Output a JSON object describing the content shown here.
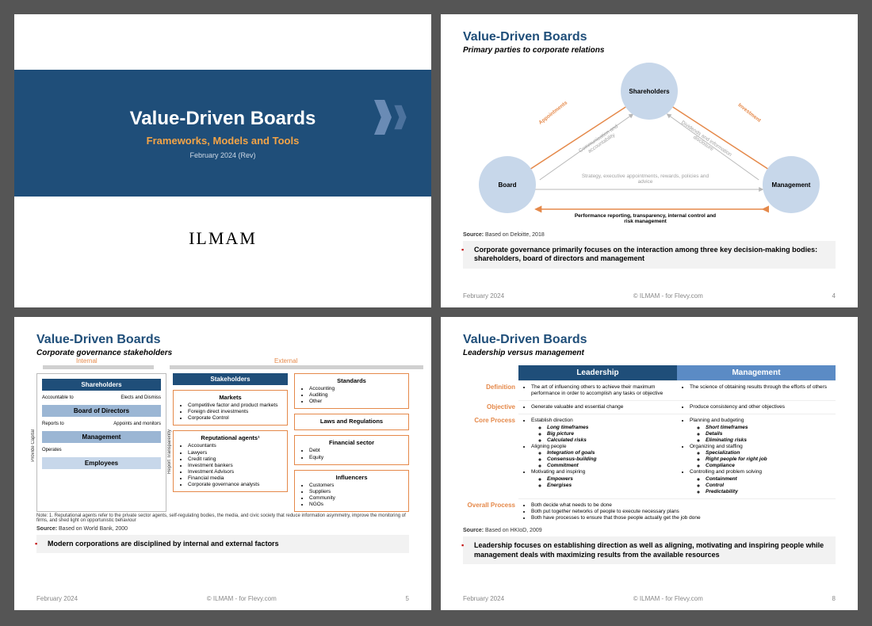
{
  "brand": "ILMAM",
  "footer": {
    "date": "February 2024",
    "copy": "© ILMAM - for Flevy.com"
  },
  "slide1": {
    "title": "Value-Driven Boards",
    "subtitle": "Frameworks, Models and Tools",
    "date": "February 2024 (Rev)"
  },
  "slide2": {
    "section": "Value-Driven Boards",
    "sub": "Primary parties to corporate relations",
    "nodes": {
      "sh": "Shareholders",
      "bd": "Board",
      "mg": "Management"
    },
    "labels": {
      "app": "Appointments",
      "inv": "Investment",
      "comm": "Communication and accountability",
      "div": "Dividends and information disclosure",
      "strat": "Strategy, executive appointments, rewards, policies and advice",
      "perf": "Performance reporting, transparency, internal control and risk management"
    },
    "source": "Source: Based on Deloitte, 2018",
    "key": "Corporate governance primarily focuses on the interaction among three key decision-making bodies: shareholders, board of directors and management",
    "page": "4"
  },
  "slide3": {
    "section": "Value-Driven Boards",
    "sub": "Corporate governance stakeholders",
    "internal": "Internal",
    "external": "External",
    "intbox": {
      "sh": "Shareholders",
      "sh_l": "Accountable to",
      "sh_r": "Elects and Dismiss",
      "bd": "Board of Directors",
      "bd_l": "Reports to",
      "bd_r": "Appoints and monitors",
      "mg": "Management",
      "mg_l": "Operates",
      "em": "Employees",
      "side_l": "Provide Capital",
      "side_r": "Report Transparently"
    },
    "stakeholders": "Stakeholders",
    "markets": {
      "h": "Markets",
      "items": [
        "Competitive factor and product markets",
        "Foreign direct investments",
        "Corporate Control"
      ]
    },
    "rep": {
      "h": "Reputational agents¹",
      "items": [
        "Accountants",
        "Lawyers",
        "Credit rating",
        "Investment bankers",
        "Investment Advisors",
        "Financial media",
        "Corporate governance analysts"
      ]
    },
    "standards": {
      "h": "Standards",
      "items": [
        "Accounting",
        "Auditing",
        "Other"
      ]
    },
    "laws": "Laws and Regulations",
    "fin": {
      "h": "Financial sector",
      "items": [
        "Debt",
        "Equity"
      ]
    },
    "inf": {
      "h": "Influencers",
      "items": [
        "Customers",
        "Suppliers",
        "Community",
        "NGOs"
      ]
    },
    "note": "Note: 1. Reputational agents refer to the private sector agents, self-regulating bodies, the media, and civic society that reduce information asymmetry, improve the monitoring of firms, and shed light on opportunistic behaviour",
    "source": "Source: Based on World Bank, 2000",
    "key": "Modern corporations are disciplined by internal and external factors",
    "page": "5"
  },
  "slide4": {
    "section": "Value-Driven Boards",
    "sub": "Leadership versus management",
    "head": {
      "l": "Leadership",
      "m": "Management"
    },
    "rows": {
      "def": {
        "label": "Definition",
        "l": "The art of influencing others to achieve their maximum performance in order to accomplish any tasks or objective",
        "m": "The science of obtaining results through the efforts of others"
      },
      "obj": {
        "label": "Objective",
        "l": "Generate valuable and essential change",
        "m": "Produce consistency and other objectives"
      },
      "core": {
        "label": "Core Process",
        "l": [
          "Establish direction",
          [
            "Long timeframes",
            "Big picture",
            "Calculated risks"
          ],
          "Aligning people",
          [
            "Integration of goals",
            "Consensus-building",
            "Commitment"
          ],
          "Motivating and inspiring",
          [
            "Empowers",
            "Energises"
          ]
        ],
        "m": [
          "Planning and budgeting",
          [
            "Short timeframes",
            "Details",
            "Eliminating risks"
          ],
          "Organizing and staffing",
          [
            "Specialization",
            "Right people for right job",
            "Compliance"
          ],
          "Controlling and problem solving",
          [
            "Containment",
            "Control",
            "Predictability"
          ]
        ]
      },
      "overall": {
        "label": "Overall Process",
        "items": [
          "Both decide what needs to be done",
          "Both put together networks of people to execute necessary plans",
          "Both have processes to ensure that those people actually get the job done"
        ]
      }
    },
    "source": "Source: Based on HKIoD, 2009",
    "key": "Leadership focuses on establishing direction as well as aligning, motivating and inspiring people while management deals with maximizing results from the available resources",
    "page": "8"
  }
}
